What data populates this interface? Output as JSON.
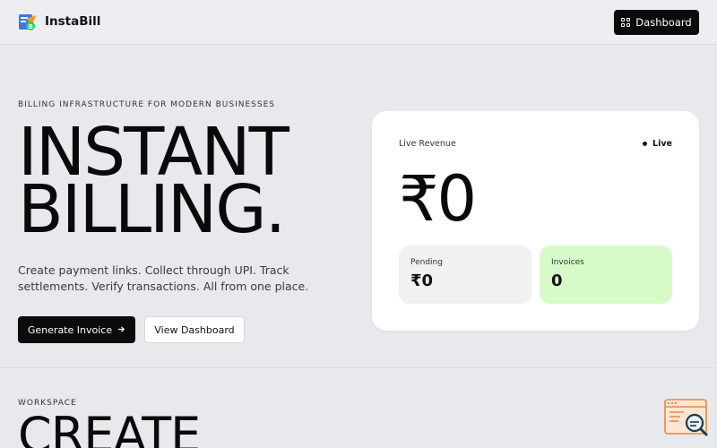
{
  "nav": {
    "brand": "InstaBill",
    "dashboard_button": "Dashboard",
    "dashboard_icon": "grid-icon"
  },
  "hero": {
    "eyebrow": "BILLING INFRASTRUCTURE FOR MODERN BUSINESSES",
    "title_line1": "INSTANT",
    "title_line2": "BILLING.",
    "description": "Create payment links. Collect through UPI. Track settlements. Verify transactions. All from one place.",
    "primary_button": "Generate Invoice",
    "primary_button_icon": "arrow-right-icon",
    "secondary_button": "View Dashboard"
  },
  "revenue_card": {
    "label": "Live Revenue",
    "status": "Live",
    "amount": "₹0",
    "stats": [
      {
        "label": "Pending",
        "value": "₹0"
      },
      {
        "label": "Invoices",
        "value": "0"
      }
    ]
  },
  "workspace": {
    "eyebrow": "WORKSPACE",
    "title": "CREATE"
  },
  "colors": {
    "background": "#e8e9ed",
    "primary": "#0b0b0b",
    "card": "#ffffff",
    "invoices_highlight": "#d6fbc9",
    "pending_bg": "#f1f1f1"
  }
}
